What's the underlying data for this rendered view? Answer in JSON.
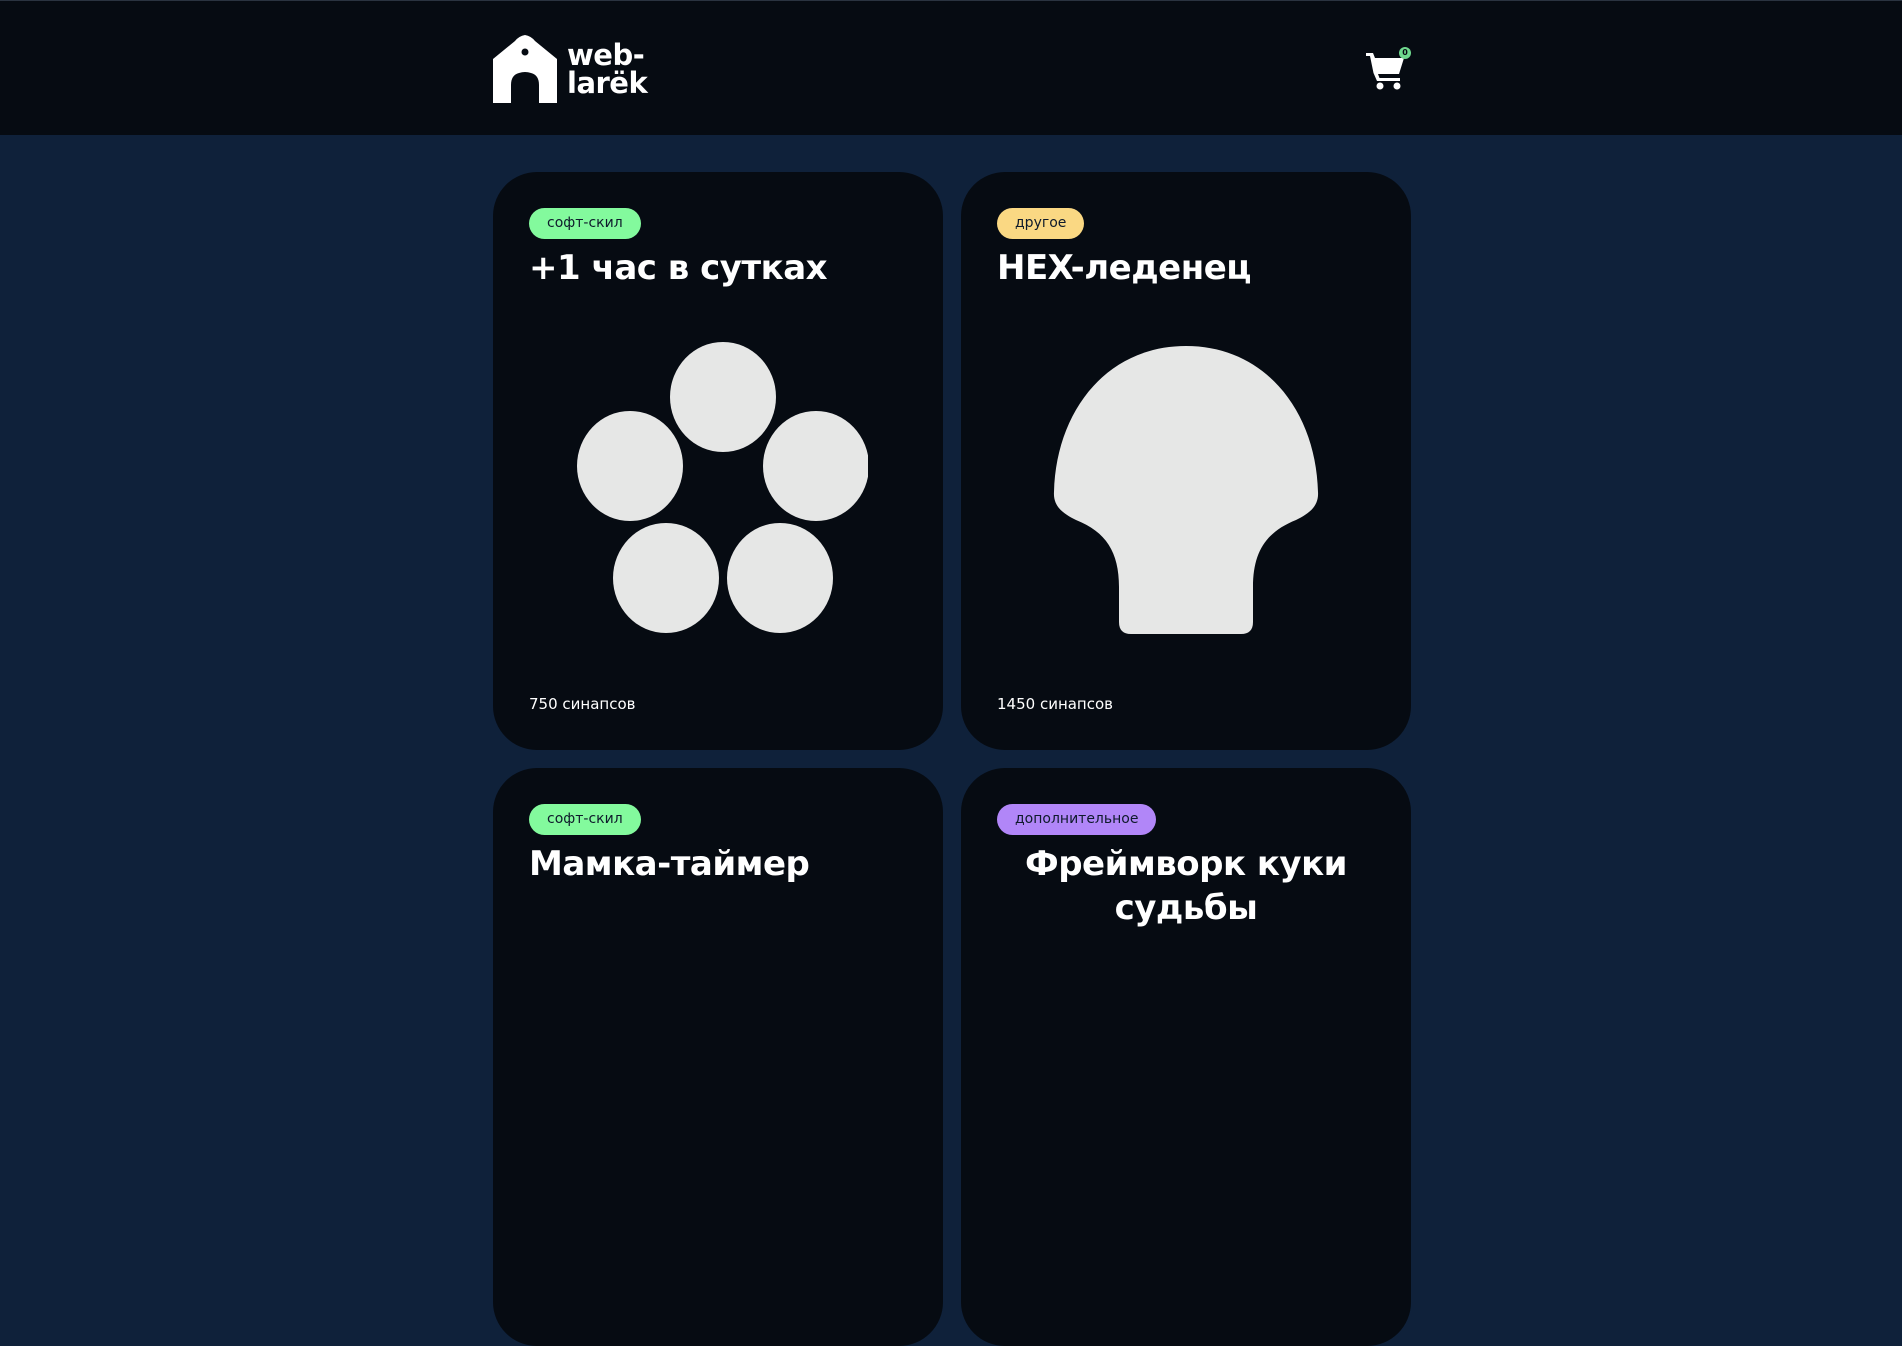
{
  "header": {
    "logo_line1": "web-",
    "logo_line2": "larёk",
    "basket_count": "0"
  },
  "cards": [
    {
      "category": "софт-скил",
      "category_color": "#83fa9d",
      "title": "+1 час в сутках",
      "image_icon": "five-circles-icon",
      "price": "750 синапсов"
    },
    {
      "category": "другое",
      "category_color": "#fad883",
      "title": "HEX-леденец",
      "image_icon": "shell-shape-icon",
      "price": "1450 синапсов"
    },
    {
      "category": "софт-скил",
      "category_color": "#83fa9d",
      "title": "Мамка-таймер"
    },
    {
      "category": "дополнительное",
      "category_color": "#b186f8",
      "title": "Фреймворк куки судьбы"
    }
  ]
}
